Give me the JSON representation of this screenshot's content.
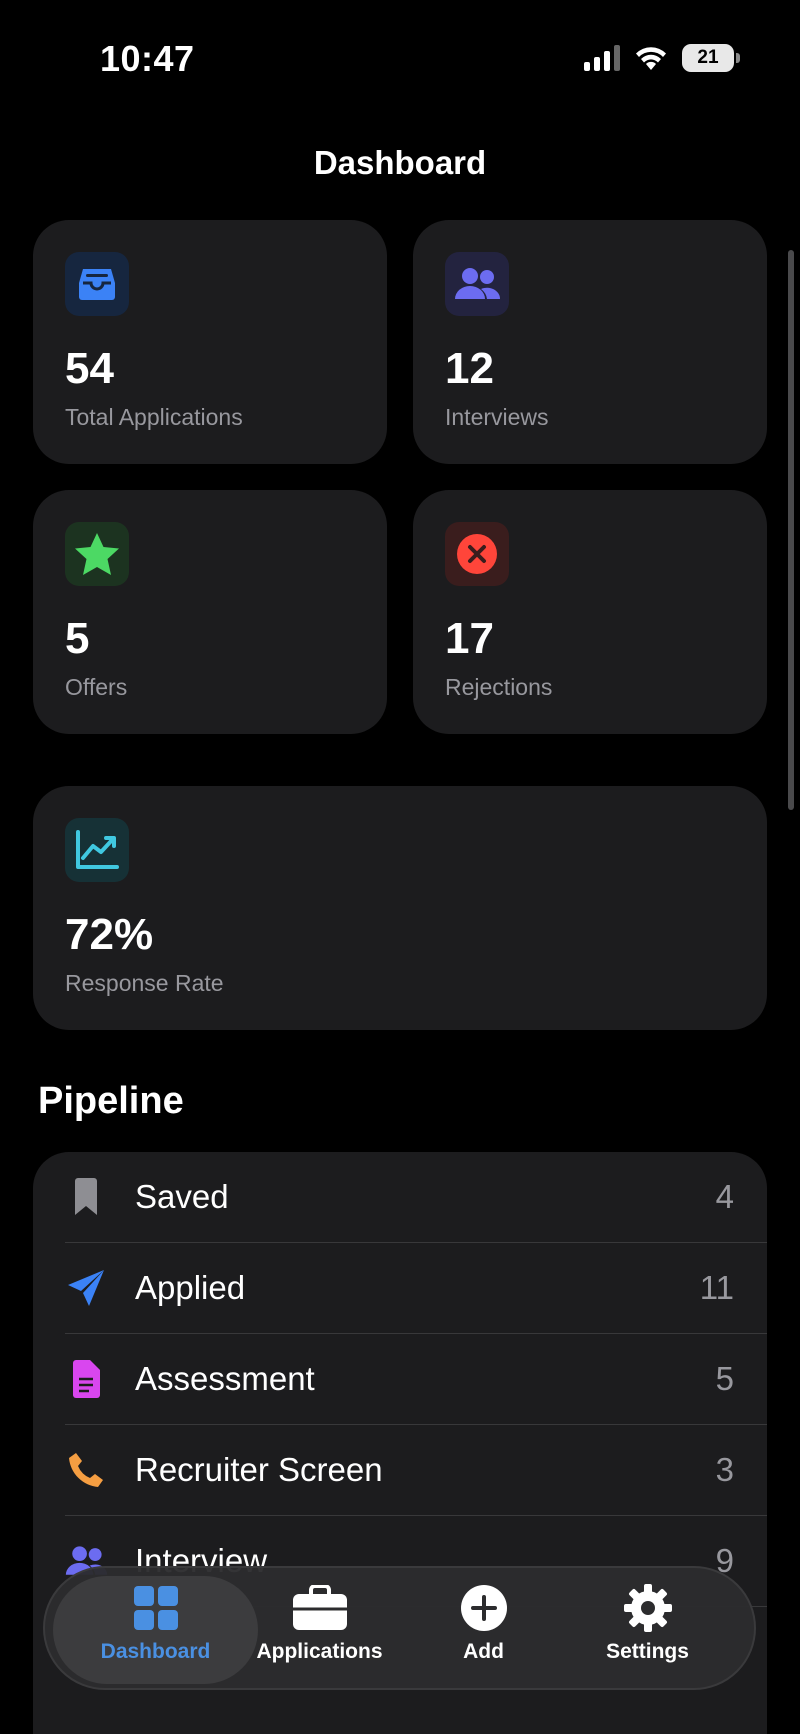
{
  "status_bar": {
    "time": "10:47",
    "battery": "21"
  },
  "page_title": "Dashboard",
  "stats": [
    {
      "value": "54",
      "label": "Total Applications",
      "icon": "tray-icon",
      "color": "#3b82f6"
    },
    {
      "value": "12",
      "label": "Interviews",
      "icon": "people-icon",
      "color": "#6c6cf0"
    },
    {
      "value": "5",
      "label": "Offers",
      "icon": "star-icon",
      "color": "#4cd964"
    },
    {
      "value": "17",
      "label": "Rejections",
      "icon": "x-circle-icon",
      "color": "#ff453a"
    }
  ],
  "response_rate": {
    "value": "72%",
    "label": "Response Rate",
    "icon": "chart-icon",
    "color": "#40c8e0"
  },
  "pipeline": {
    "title": "Pipeline",
    "items": [
      {
        "label": "Saved",
        "count": "4",
        "icon": "bookmark-icon",
        "color": "#8e8e93"
      },
      {
        "label": "Applied",
        "count": "11",
        "icon": "paperplane-icon",
        "color": "#3b82f6"
      },
      {
        "label": "Assessment",
        "count": "5",
        "icon": "document-icon",
        "color": "#d946ef"
      },
      {
        "label": "Recruiter Screen",
        "count": "3",
        "icon": "phone-icon",
        "color": "#f59e42"
      },
      {
        "label": "Interview",
        "count": "9",
        "icon": "people-icon",
        "color": "#6c6cf0"
      }
    ]
  },
  "tab_bar": {
    "tabs": [
      {
        "label": "Dashboard",
        "icon": "grid-icon",
        "active": true
      },
      {
        "label": "Applications",
        "icon": "briefcase-icon"
      },
      {
        "label": "Add",
        "icon": "plus-circle-icon"
      },
      {
        "label": "Settings",
        "icon": "gear-icon"
      }
    ]
  },
  "colors": {
    "accent": "#4a90e2",
    "card_bg": "#1c1c1e",
    "background": "#000000"
  }
}
